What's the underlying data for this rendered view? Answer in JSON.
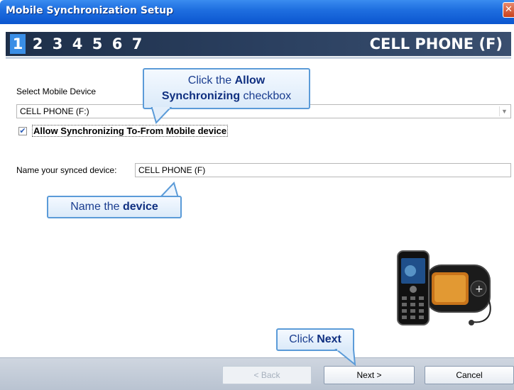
{
  "window": {
    "title": "Mobile Synchronization Setup",
    "close_glyph": "✕"
  },
  "steps": {
    "items": [
      "1",
      "2",
      "3",
      "4",
      "5",
      "6",
      "7"
    ],
    "active": "1",
    "device_title": "CELL PHONE (F)"
  },
  "form": {
    "select_device_label": "Select Mobile Device",
    "select_device_value": "CELL PHONE (F:)",
    "dropdown_glyph": "▼",
    "allow_sync_checked": true,
    "allow_sync_check_glyph": "✔",
    "allow_sync_label": "Allow Synchronizing To-From Mobile device",
    "name_label": "Name your synced device:",
    "name_value": "CELL PHONE (F)"
  },
  "callouts": {
    "allow": {
      "prefix": "Click the ",
      "bold1": "Allow",
      "bold2": "Synchronizing",
      "suffix": " checkbox"
    },
    "name": {
      "prefix": "Name the ",
      "bold": "device"
    },
    "next": {
      "prefix": "Click ",
      "bold": "Next"
    }
  },
  "buttons": {
    "back": "< Back",
    "next": "Next >",
    "cancel": "Cancel"
  },
  "colors": {
    "titlebar": "#0b55cf",
    "stepbar": "#2a3f5f",
    "active_step": "#3a8ee6",
    "callout_border": "#5b9bd8",
    "callout_text": "#1a3d8f"
  }
}
